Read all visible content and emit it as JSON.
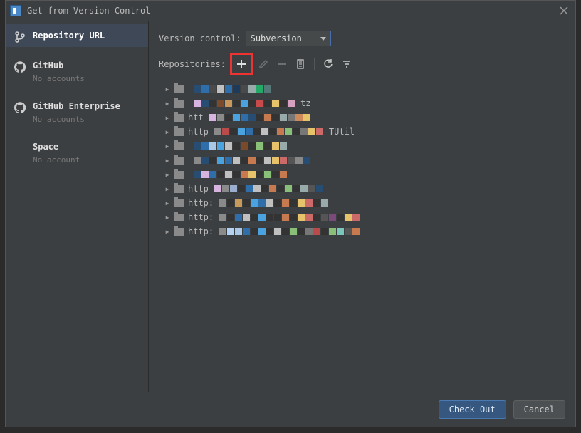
{
  "title": "Get from Version Control",
  "sidebar": {
    "items": [
      {
        "label": "Repository URL",
        "sub": ""
      },
      {
        "label": "GitHub",
        "sub": "No accounts"
      },
      {
        "label": "GitHub Enterprise",
        "sub": "No accounts"
      },
      {
        "label": "Space",
        "sub": "No account"
      }
    ]
  },
  "main": {
    "vc_label": "Version control:",
    "vc_value": "Subversion",
    "repos_label": "Repositories:"
  },
  "tree": [
    {
      "name": ""
    },
    {
      "name": ""
    },
    {
      "name": "htt"
    },
    {
      "name": "http"
    },
    {
      "name": ""
    },
    {
      "name": ""
    },
    {
      "name": ""
    },
    {
      "name": "http"
    },
    {
      "name": "http:"
    },
    {
      "name": "http:"
    },
    {
      "name": "http:"
    }
  ],
  "tree_extra": {
    "row1_suffix": "tz",
    "row3_suffix": "TUtil"
  },
  "footer": {
    "primary": "Check Out",
    "secondary": "Cancel"
  },
  "mosaic_palettes": [
    [
      "#274d73",
      "#2f6ea8",
      "#4a4a4a",
      "#c0c0c0",
      "#2f6ea8",
      "#1e3a5a",
      "#4a4a4a",
      "#9aa",
      "#2a6",
      "#577"
    ],
    [
      "#d7b3e0",
      "#274d73",
      "#333",
      "#7a4a2a",
      "#c7975b",
      "#333",
      "#4aa3df",
      "#333",
      "#c84a4a",
      "#333",
      "#e6c36a",
      "#333",
      "#d8a0c0"
    ],
    [
      "#d7b3e0",
      "#8a8a8a",
      "#333",
      "#4aa3df",
      "#2f6ea8",
      "#274d73",
      "#333",
      "#c77a50",
      "#333",
      "#9aa",
      "#777",
      "#cc8a5a",
      "#e6c36a"
    ],
    [
      "#8a8a8a",
      "#bb4a4a",
      "#333",
      "#4aa3df",
      "#2f6ea8",
      "#333",
      "#c0c0c0",
      "#333",
      "#c77a50",
      "#8abf7a",
      "#333",
      "#777",
      "#e6c36a",
      "#cc6a6a"
    ],
    [
      "#274d73",
      "#2f6ea8",
      "#aac8e6",
      "#4aa3df",
      "#c0c0c0",
      "#333",
      "#7a4a2a",
      "#333",
      "#8abf7a",
      "#333",
      "#e6c36a",
      "#9aa"
    ],
    [
      "#8a8a8a",
      "#274d73",
      "#333",
      "#4aa3df",
      "#2f6ea8",
      "#c0c0c0",
      "#333",
      "#c77a50",
      "#333",
      "#c0c0c0",
      "#e6c36a",
      "#cc6a6a",
      "#555",
      "#888",
      "#274d73"
    ],
    [
      "#274d73",
      "#d7b3e0",
      "#2f6ea8",
      "#333",
      "#c0c0c0",
      "#333",
      "#c77a50",
      "#e6c36a",
      "#333",
      "#8abf7a",
      "#333",
      "#c77a50"
    ],
    [
      "#d7b3e0",
      "#8a8a8a",
      "#9aaed0",
      "#333",
      "#2f6ea8",
      "#c0c0c0",
      "#333",
      "#c77a50",
      "#333",
      "#8abf7a",
      "#333",
      "#9aa",
      "#555",
      "#274d73"
    ],
    [
      "#8a8a8a",
      "#333",
      "#c89a5a",
      "#333",
      "#4aa3df",
      "#2f6ea8",
      "#c0c0c0",
      "#333",
      "#c77a50",
      "#333",
      "#e6c36a",
      "#cc6a6a",
      "#333",
      "#9aa"
    ],
    [
      "#8a8a8a",
      "#333",
      "#2f6ea8",
      "#c0c0c0",
      "#333",
      "#4aa3df",
      "#333",
      "#333",
      "#c77a50",
      "#333",
      "#e6c36a",
      "#cc6a6a",
      "#333",
      "#555",
      "#7a4a7a",
      "#333",
      "#e6c36a",
      "#cc6a6a"
    ],
    [
      "#8a8a8a",
      "#b3d1f0",
      "#aac8e6",
      "#2f6ea8",
      "#333",
      "#4aa3df",
      "#333",
      "#c0c0c0",
      "#333",
      "#8abf7a",
      "#333",
      "#777",
      "#bb4a4a",
      "#333",
      "#8abf7a",
      "#7ac6b8",
      "#555",
      "#c77a50"
    ]
  ]
}
